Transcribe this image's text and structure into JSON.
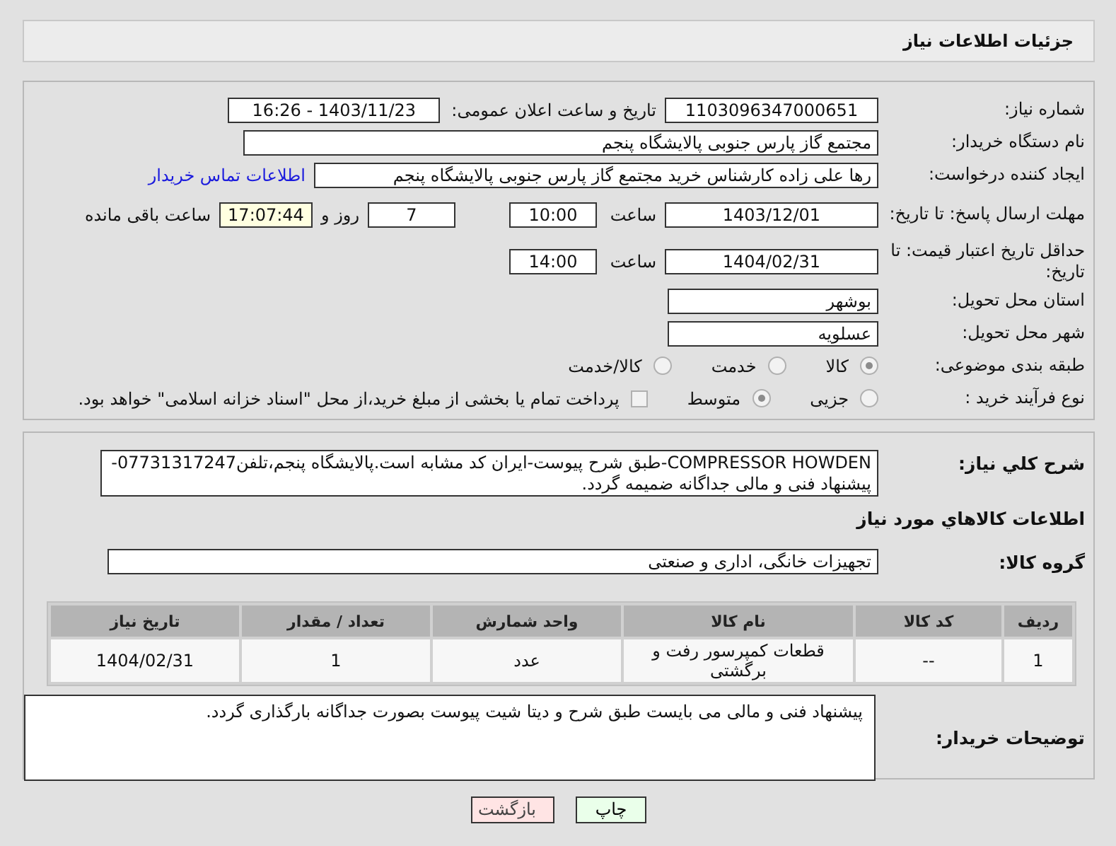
{
  "page_title": "جزئیات اطلاعات نیاز",
  "need_number": {
    "label": "شماره نیاز:",
    "value": "1103096347000651"
  },
  "announce": {
    "label": "تاریخ و ساعت اعلان عمومی:",
    "value": "1403/11/23 - 16:26"
  },
  "buyer": {
    "label": "نام دستگاه خریدار:",
    "value": "مجتمع گاز پارس جنوبی  پالایشگاه پنجم"
  },
  "requester": {
    "label": "ایجاد کننده درخواست:",
    "value": "رها علی زاده کارشناس خرید مجتمع گاز پارس جنوبی  پالایشگاه پنجم",
    "link": "اطلاعات تماس خریدار"
  },
  "deadline": {
    "label": "مهلت ارسال پاسخ: تا تاریخ:",
    "date": "1403/12/01",
    "time_label": "ساعت",
    "time": "10:00",
    "days": "7",
    "days_label": "روز و",
    "remaining": "17:07:44",
    "remaining_label": "ساعت باقی مانده"
  },
  "validity": {
    "label": "حداقل تاریخ اعتبار قیمت: تا تاریخ:",
    "date": "1404/02/31",
    "time_label": "ساعت",
    "time": "14:00"
  },
  "province": {
    "label": "استان محل تحویل:",
    "value": "بوشهر"
  },
  "city": {
    "label": "شهر محل تحویل:",
    "value": "عسلویه"
  },
  "category": {
    "label": "طبقه بندی موضوعی:",
    "options": [
      {
        "label": "کالا",
        "selected": true
      },
      {
        "label": "خدمت",
        "selected": false
      },
      {
        "label": "کالا/خدمت",
        "selected": false
      }
    ]
  },
  "process": {
    "label": "نوع فرآیند خرید :",
    "options": [
      {
        "label": "جزیی",
        "selected": false
      },
      {
        "label": "متوسط",
        "selected": true
      }
    ],
    "payment": {
      "label": "پرداخت تمام یا بخشی از مبلغ خرید،از محل \"اسناد خزانه اسلامی\" خواهد بود.",
      "checked": false
    }
  },
  "description": {
    "label": "شرح کلي نیاز:",
    "value": "COMPRESSOR HOWDEN-طبق شرح پیوست-ایران کد مشابه است.پالایشگاه پنجم،تلفن07731317247- پیشنهاد فنی و مالی جداگانه ضمیمه گردد."
  },
  "goods_heading": "اطلاعات کالاهاي مورد نیاز",
  "goods_group": {
    "label": "گروه کالا:",
    "value": "تجهیزات خانگی، اداری و صنعتی"
  },
  "table": {
    "columns": [
      "ردیف",
      "کد کالا",
      "نام کالا",
      "واحد شمارش",
      "تعداد / مقدار",
      "تاریخ نیاز"
    ],
    "rows": [
      [
        "1",
        "--",
        "قطعات کمپرسور رفت و برگشتی",
        "عدد",
        "1",
        "1404/02/31"
      ]
    ]
  },
  "buyer_notes": {
    "label": "توضیحات خریدار:",
    "value": "پیشنهاد فنی و مالی می بایست طبق شرح و دیتا شیت پیوست بصورت جداگانه بارگذاری گردد."
  },
  "buttons": [
    {
      "label": "چاپ",
      "kind": "print"
    },
    {
      "label": "بازگشت",
      "kind": "back"
    }
  ]
}
